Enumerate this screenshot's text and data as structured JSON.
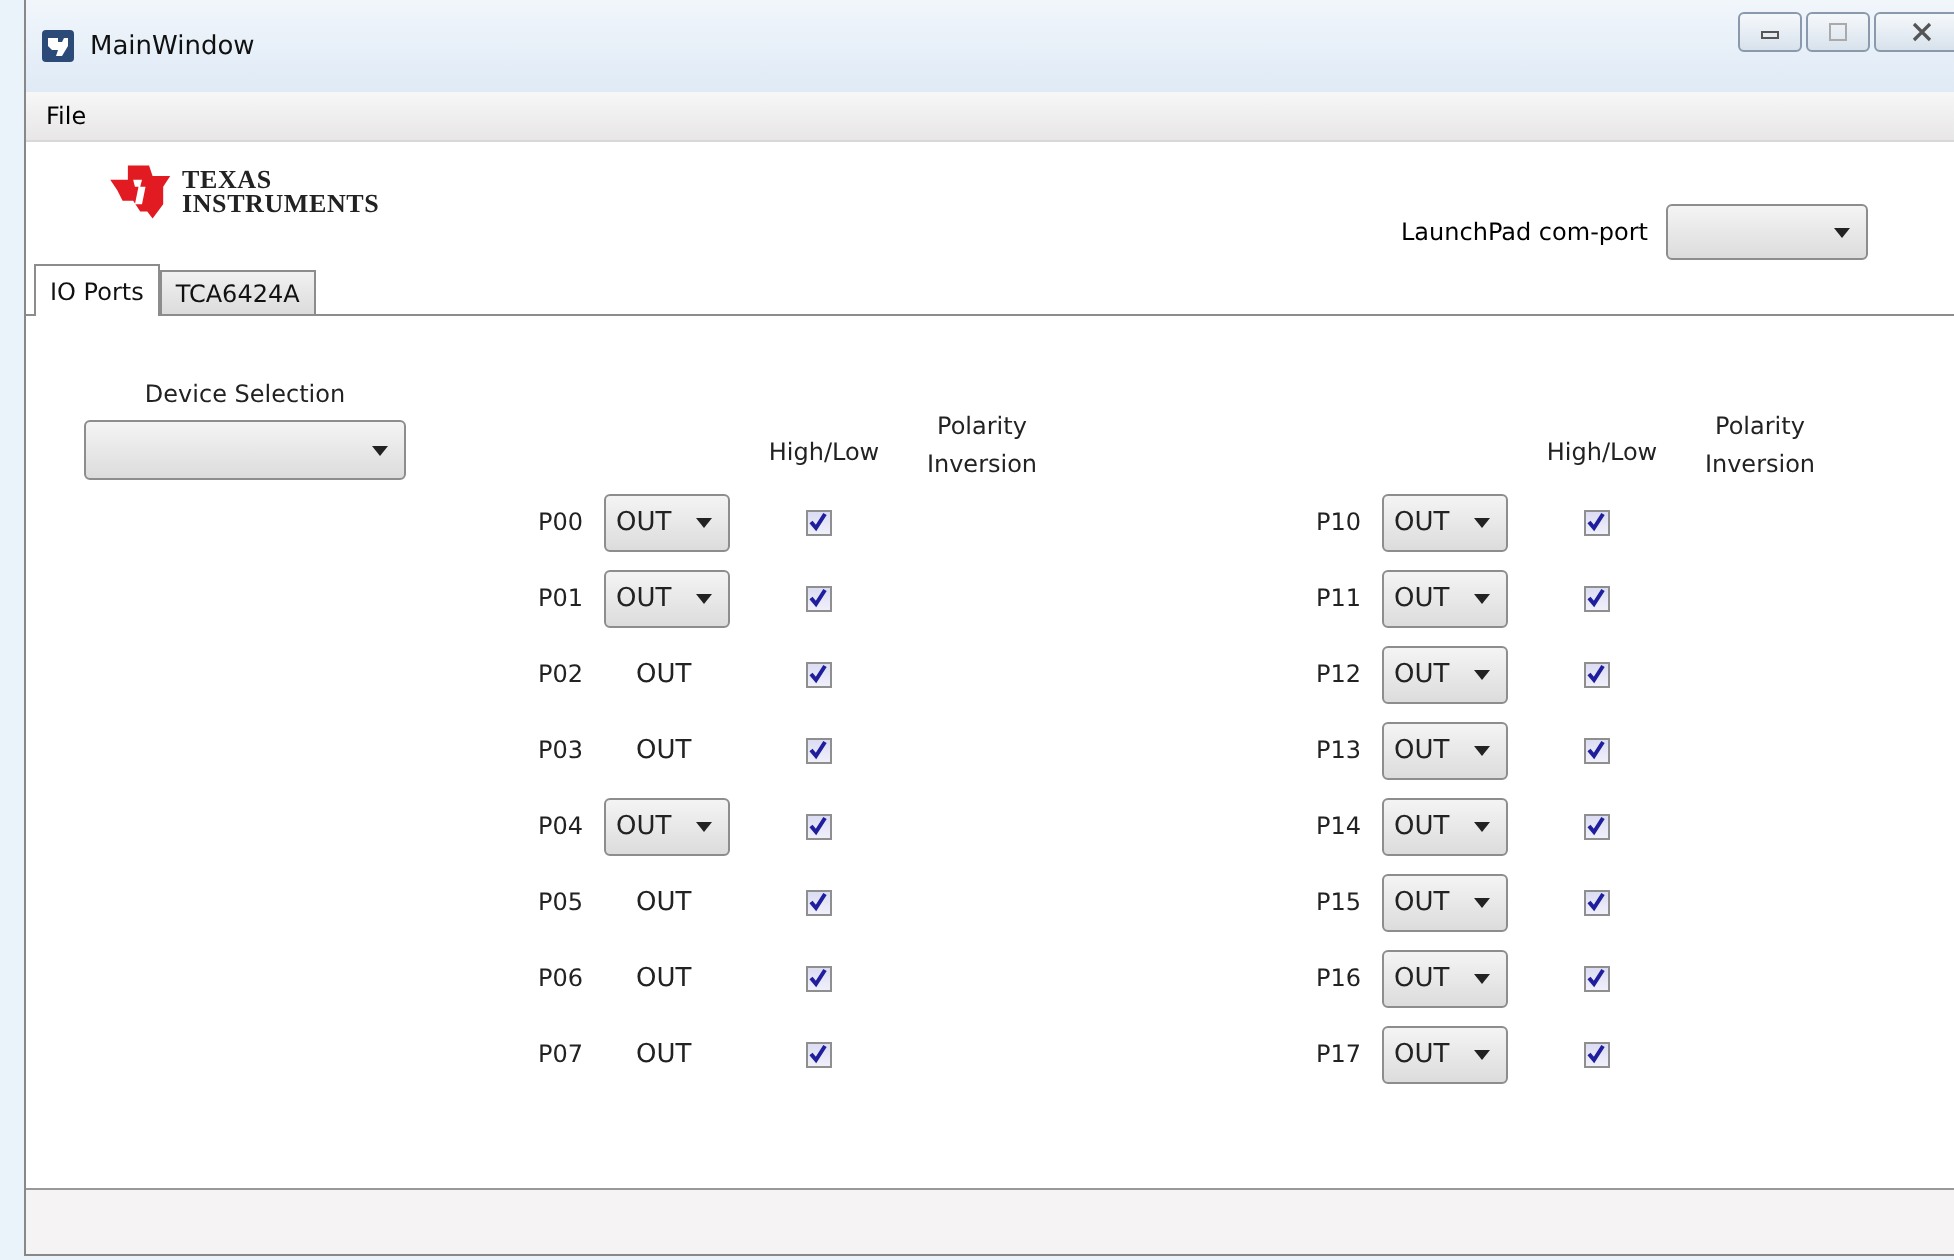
{
  "window": {
    "title": "MainWindow"
  },
  "menu": [
    "File"
  ],
  "logo": {
    "line1": "TEXAS",
    "line2": "INSTRUMENTS"
  },
  "com_port": {
    "label": "LaunchPad com-port"
  },
  "tabs": [
    {
      "label": "IO Ports",
      "selected": true
    },
    {
      "label": "TCA6424A",
      "selected": false
    }
  ],
  "device_selection": {
    "label": "Device Selection"
  },
  "port_groups": [
    {
      "headers": {
        "high_low": "High/Low",
        "polarity": "Polarity Inversion"
      },
      "ports": [
        {
          "name": "P00",
          "kind": "dropdown",
          "mode": "OUT",
          "checked": true
        },
        {
          "name": "P01",
          "kind": "dropdown",
          "mode": "OUT",
          "checked": true
        },
        {
          "name": "P02",
          "kind": "text",
          "mode": "OUT",
          "checked": true
        },
        {
          "name": "P03",
          "kind": "text",
          "mode": "OUT",
          "checked": true
        },
        {
          "name": "P04",
          "kind": "dropdown",
          "mode": "OUT",
          "checked": true
        },
        {
          "name": "P05",
          "kind": "text",
          "mode": "OUT",
          "checked": true
        },
        {
          "name": "P06",
          "kind": "text",
          "mode": "OUT",
          "checked": true
        },
        {
          "name": "P07",
          "kind": "text",
          "mode": "OUT",
          "checked": true
        }
      ]
    },
    {
      "headers": {
        "high_low": "High/Low",
        "polarity": "Polarity Inversion"
      },
      "ports": [
        {
          "name": "P10",
          "kind": "dropdown",
          "mode": "OUT",
          "checked": true
        },
        {
          "name": "P11",
          "kind": "dropdown",
          "mode": "OUT",
          "checked": true
        },
        {
          "name": "P12",
          "kind": "dropdown",
          "mode": "OUT",
          "checked": true
        },
        {
          "name": "P13",
          "kind": "dropdown",
          "mode": "OUT",
          "checked": true
        },
        {
          "name": "P14",
          "kind": "dropdown",
          "mode": "OUT",
          "checked": true
        },
        {
          "name": "P15",
          "kind": "dropdown",
          "mode": "OUT",
          "checked": true
        },
        {
          "name": "P16",
          "kind": "dropdown",
          "mode": "OUT",
          "checked": true
        },
        {
          "name": "P17",
          "kind": "dropdown",
          "mode": "OUT",
          "checked": true
        }
      ]
    }
  ]
}
